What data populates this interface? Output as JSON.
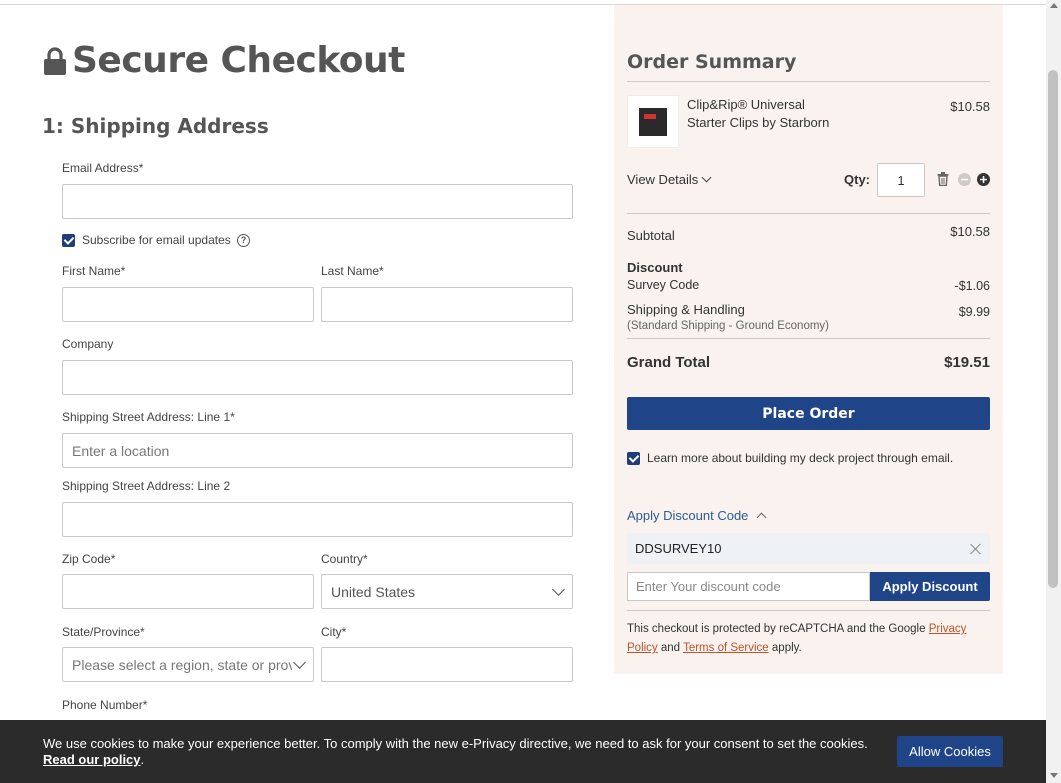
{
  "page": {
    "title": "Secure Checkout",
    "section_heading": "1: Shipping Address"
  },
  "form": {
    "email_label": "Email Address*",
    "subscribe_label": "Subscribe for email updates",
    "first_name_label": "First Name*",
    "last_name_label": "Last Name*",
    "company_label": "Company",
    "street1_label": "Shipping Street Address: Line 1*",
    "street1_placeholder": "Enter a location",
    "street2_label": "Shipping Street Address: Line 2",
    "zip_label": "Zip Code*",
    "country_label": "Country*",
    "country_value": "United States",
    "state_label": "State/Province*",
    "state_placeholder": "Please select a region, state or province",
    "city_label": "City*",
    "phone_label": "Phone Number*"
  },
  "summary": {
    "title": "Order Summary",
    "product_name": "Clip&Rip® Universal Starter Clips by Starborn",
    "product_price": "$10.58",
    "view_details": "View Details",
    "qty_label": "Qty:",
    "qty_value": "1",
    "subtotal_label": "Subtotal",
    "subtotal_value": "$10.58",
    "discount_label": "Discount",
    "survey_label": "Survey Code",
    "survey_value": "-$1.06",
    "shipping_label": "Shipping & Handling",
    "shipping_note": "(Standard Shipping - Ground Economy)",
    "shipping_value": "$9.99",
    "grand_total_label": "Grand Total",
    "grand_total_value": "$19.51",
    "place_order": "Place Order",
    "learn_more": "Learn more about building my deck project through email.",
    "apply_discount_toggle": "Apply Discount Code",
    "applied_code": "DDSURVEY10",
    "discount_placeholder": "Enter Your discount code",
    "apply_discount_button": "Apply Discount",
    "legal_1": "This checkout is protected by reCAPTCHA and the Google ",
    "privacy_link": "Privacy Policy",
    "legal_2": " and ",
    "terms_link": "Terms of Service",
    "legal_3": " apply."
  },
  "cookie": {
    "message": "We use cookies to make your experience better. To comply with the new e-Privacy directive, we need to ask for your consent to set the cookies.",
    "policy_link": "Read our policy",
    "button": "Allow Cookies"
  },
  "colors": {
    "accent": "#1f4588",
    "summary_bg": "#f9f2ee",
    "link": "#c0532c"
  }
}
